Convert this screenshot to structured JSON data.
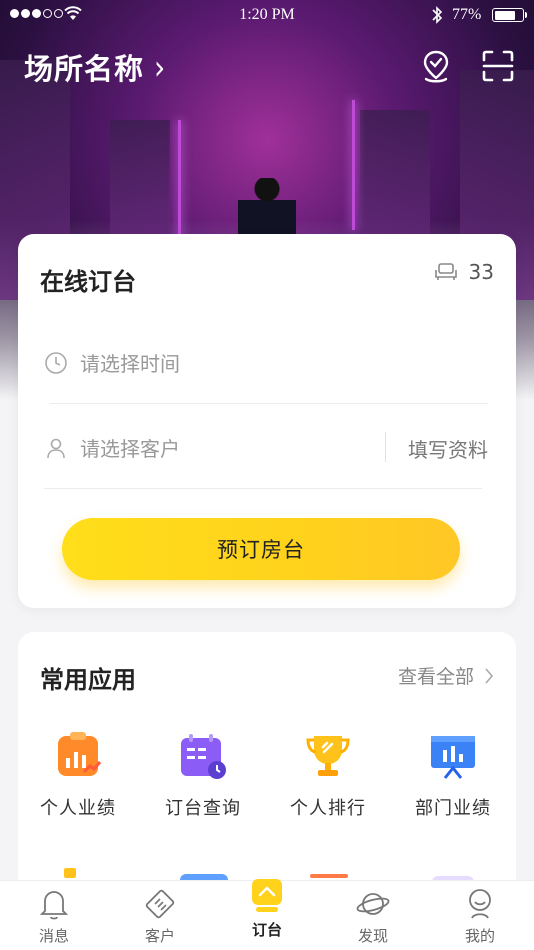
{
  "status_bar": {
    "time": "1:20 PM",
    "battery_pct": "77%",
    "battery_level": 0.77,
    "signal_dots_filled": 3,
    "signal_dots_total": 5
  },
  "header": {
    "venue_name": "场所名称",
    "chevron": "›",
    "icons": [
      "location-check-icon",
      "scan-icon"
    ]
  },
  "order_card": {
    "title": "在线订台",
    "seat_count": "33",
    "time_placeholder": "请选择时间",
    "customer_placeholder": "请选择客户",
    "fill_info_label": "填写资料",
    "book_button_label": "预订房台"
  },
  "apps_card": {
    "title": "常用应用",
    "view_all_label": "查看全部",
    "apps": [
      {
        "label": "个人业绩",
        "icon": "personal-performance-icon"
      },
      {
        "label": "订台查询",
        "icon": "booking-query-icon"
      },
      {
        "label": "个人排行",
        "icon": "personal-ranking-icon"
      },
      {
        "label": "部门业绩",
        "icon": "department-performance-icon"
      }
    ]
  },
  "tab_bar": {
    "tabs": [
      {
        "label": "消息",
        "icon": "bell-icon"
      },
      {
        "label": "客户",
        "icon": "handshake-icon"
      },
      {
        "label": "订台",
        "icon": "booking-tab-icon",
        "active": true
      },
      {
        "label": "发现",
        "icon": "planet-icon"
      },
      {
        "label": "我的",
        "icon": "profile-icon"
      }
    ]
  },
  "colors": {
    "accent_yellow": "#ffd21c",
    "hero_purple": "#5a1a70"
  }
}
